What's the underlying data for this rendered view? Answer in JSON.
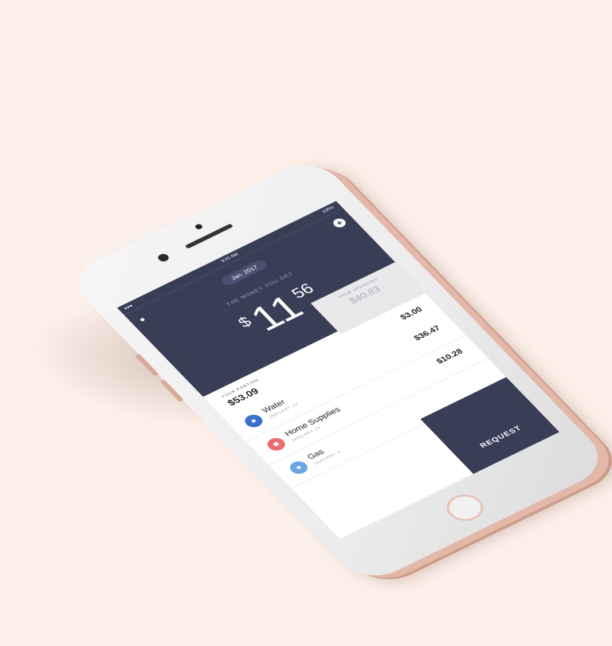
{
  "status_bar": {
    "time": "9:41 AM",
    "battery": "100%"
  },
  "header": {
    "month": "Jan. 2017",
    "money_label": "THE MONEY YOU GET",
    "currency": "$",
    "amount_whole": "11",
    "amount_cents": "56"
  },
  "spending": {
    "label": "YOUR SPENDING",
    "value": "$40.83"
  },
  "portion": {
    "label": "YOUR PORTION",
    "value": "$53.09"
  },
  "top_amount": "$3.00",
  "transactions": [
    {
      "name": "Water",
      "date": "JANUARY 19",
      "amount": "$36.47",
      "icon": "water-drop-icon",
      "color": "#3b6fd1"
    },
    {
      "name": "Home Supplies",
      "date": "JANUARY 15",
      "amount": "$10.28",
      "icon": "store-icon",
      "color": "#ef6b6b"
    },
    {
      "name": "Gas",
      "date": "JANUARY 3",
      "amount": "",
      "icon": "flame-icon",
      "color": "#6aa5e8"
    }
  ],
  "request_label": "REQUEST"
}
